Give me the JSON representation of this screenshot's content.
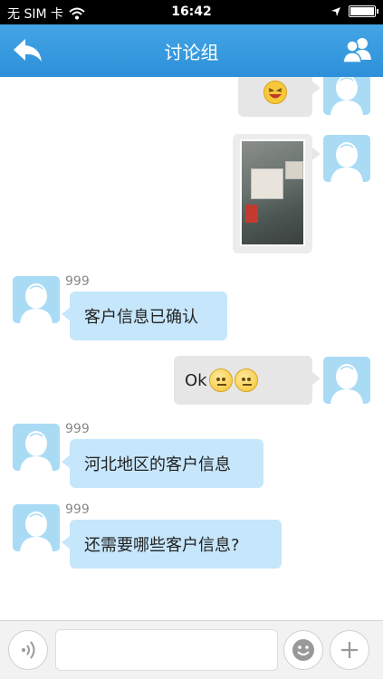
{
  "status_bar": {
    "carrier": "无 SIM 卡",
    "time": "16:42"
  },
  "nav": {
    "title": "讨论组",
    "back_icon": "back-arrow-icon",
    "group_icon": "group-members-icon"
  },
  "messages": [
    {
      "direction": "out",
      "type": "emoji",
      "emoji": "laughing-face"
    },
    {
      "direction": "out",
      "type": "image",
      "description_icon": "photo-thumbnail"
    },
    {
      "direction": "in",
      "sender": "999",
      "text": "客户信息已确认"
    },
    {
      "direction": "out",
      "type": "text_emoji",
      "text": "Ok",
      "emojis": [
        "neutral-face",
        "neutral-face"
      ]
    },
    {
      "direction": "in",
      "sender": "999",
      "text": "河北地区的客户信息"
    },
    {
      "direction": "in",
      "sender": "999",
      "text": "还需要哪些客户信息?"
    }
  ],
  "input_bar": {
    "voice_icon": "voice-icon",
    "text_value": "",
    "emoji_icon": "smiley-icon",
    "plus_icon": "plus-icon"
  },
  "colors": {
    "nav_bar": "#3a9ddf",
    "incoming_bubble": "#c6e6fb",
    "outgoing_bubble": "#e6e6e6",
    "avatar": "#a9dbf5"
  }
}
